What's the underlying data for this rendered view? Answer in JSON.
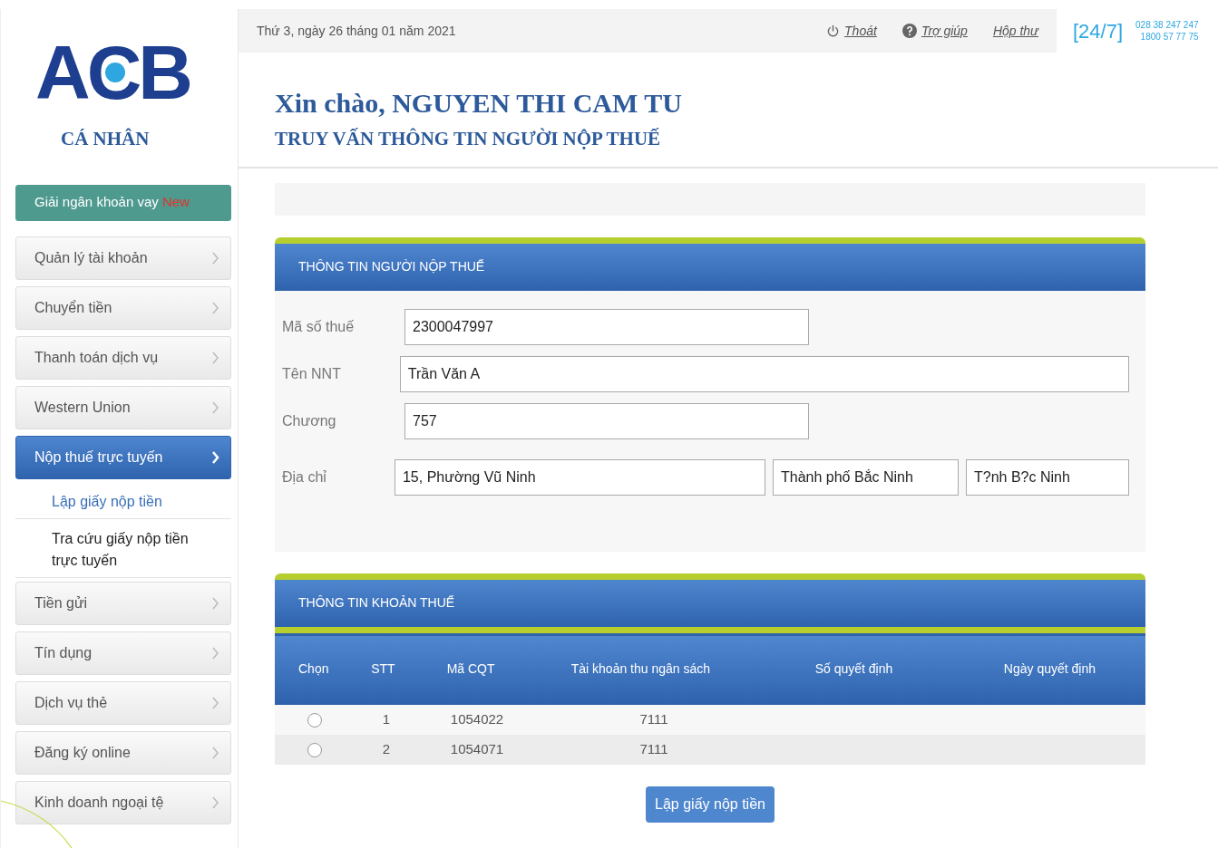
{
  "logo": {
    "brand": "ACB",
    "subtitle": "CÁ NHÂN"
  },
  "top_bar": {
    "date": "Thứ 3, ngày 26 tháng 01 năm 2021",
    "links": [
      {
        "label": "Thoát"
      },
      {
        "label": "Trợ giúp"
      },
      {
        "label": "Hộp thư"
      }
    ]
  },
  "hotline": {
    "badge": "[24/7]",
    "numbers": [
      "028 38 247 247",
      "1800 57 77 75"
    ]
  },
  "sidebar": {
    "items": [
      {
        "kind": "promo",
        "label": "Giải ngân khoản vay",
        "tag": "New"
      },
      {
        "kind": "menu",
        "label": "Quản lý tài khoản",
        "selected": false
      },
      {
        "kind": "menu",
        "label": "Chuyển tiền",
        "selected": false
      },
      {
        "kind": "menu",
        "label": "Thanh toán dịch vụ",
        "selected": false
      },
      {
        "kind": "menu",
        "label": "Western Union",
        "selected": false
      },
      {
        "kind": "menu",
        "label": "Nộp thuế trực tuyến",
        "selected": true
      },
      {
        "kind": "sub",
        "label": "Lập giấy nộp tiền",
        "selected": true
      },
      {
        "kind": "sub",
        "label": "Tra cứu giấy nộp tiền trực tuyến",
        "selected": false
      },
      {
        "kind": "menu",
        "label": "Tiền gửi",
        "selected": false
      },
      {
        "kind": "menu",
        "label": "Tín dụng",
        "selected": false
      },
      {
        "kind": "menu",
        "label": "Dịch vụ thẻ",
        "selected": false
      },
      {
        "kind": "menu",
        "label": "Đăng ký online",
        "selected": false
      },
      {
        "kind": "menu",
        "label": "Kinh doanh ngoại tệ",
        "selected": false
      }
    ]
  },
  "greeting": "Xin chào, NGUYEN THI CAM TU",
  "page_title": "TRUY VẤN THÔNG TIN NGƯỜI NỘP THUẾ",
  "taxpayer_panel": {
    "title": "THÔNG TIN NGƯỜI NỘP THUẾ",
    "fields": [
      {
        "label": "Mã số thuế",
        "values": [
          "2300047997"
        ],
        "kind": "short"
      },
      {
        "label": "Tên NNT",
        "values": [
          "Trần Văn A"
        ],
        "kind": "long"
      },
      {
        "label": "Chương",
        "values": [
          "757"
        ],
        "kind": "short"
      },
      {
        "label": "Địa chỉ",
        "values": [
          "15, Phường Vũ Ninh",
          "Thành phố Bắc Ninh",
          "T?nh B?c Ninh"
        ],
        "kind": "address"
      }
    ]
  },
  "tax_panel": {
    "title": "THÔNG TIN KHOẢN THUẾ",
    "table": {
      "columns": [
        "Chọn",
        "STT",
        "Mã CQT",
        "Tài khoản thu ngân sách",
        "Số quyết định",
        "Ngày quyết định"
      ],
      "rows": [
        {
          "selected": false,
          "cells": [
            "",
            "1",
            "1054022",
            "7111",
            "",
            ""
          ]
        },
        {
          "selected": false,
          "cells": [
            "",
            "2",
            "1054071",
            "7111",
            "",
            ""
          ]
        }
      ]
    }
  },
  "submit_button": "Lập giấy nộp tiền"
}
